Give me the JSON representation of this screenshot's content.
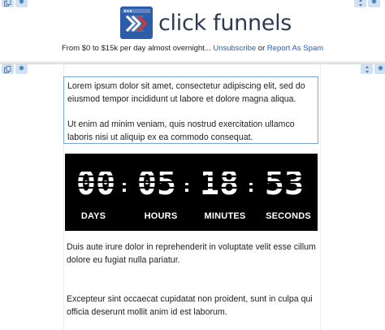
{
  "header": {
    "logo_text": "click funnels",
    "subline_text": "From $0 to $15k per day almost overnight...",
    "unsubscribe_label": "Unsubscribe",
    "or_text": "or",
    "report_label": "Report As Spam"
  },
  "selected_block": {
    "paragraph_1": "Lorem ipsum dolor sit amet, consectetur adipiscing elit, sed do eiusmod tempor incididunt ut labore et dolore magna aliqua.",
    "paragraph_2": "Ut enim ad minim veniam, quis nostrud exercitation ullamco laboris nisi ut aliquip ex ea commodo consequat."
  },
  "countdown": {
    "days": "00",
    "hours": "05",
    "minutes": "18",
    "seconds": "53",
    "separator": ":",
    "labels": {
      "days": "DAYS",
      "hours": "HOURS",
      "minutes": "MINUTES",
      "seconds": "SECONDS"
    }
  },
  "lower": {
    "paragraph_1": "Duis aute irure dolor in reprehenderit in voluptate velit esse cillum dolore eu fugiat nulla pariatur.",
    "paragraph_2": "Excepteur sint occaecat cupidatat non proident, sunt in culpa qui officia deserunt mollit anim id est laborum."
  },
  "colors": {
    "accent_link": "#1f5fbf",
    "toolbar_bg": "#cfe1f2",
    "logo_blue": "#2d5ca8",
    "logo_red": "#d33a2c",
    "countdown_bg": "#000000"
  },
  "icons": {
    "toolbar": [
      "copy-icon",
      "gear-icon",
      "move-icon"
    ]
  }
}
